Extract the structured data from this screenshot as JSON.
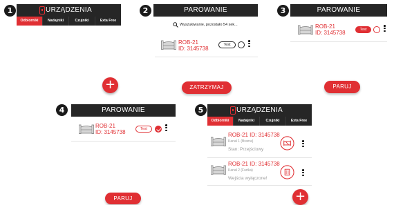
{
  "steps": [
    "1",
    "2",
    "3",
    "4",
    "5"
  ],
  "screen1": {
    "title": "URZĄDZENIA",
    "tabs": [
      "Odbiorniki",
      "Nadajniki",
      "Czujniki",
      "Exta Free"
    ],
    "fab": "+"
  },
  "screen2": {
    "title": "PAROWANIE",
    "search_text": "Wyszukiwanie, pozostało 54 sek...",
    "device": {
      "name": "ROB-21",
      "id": "ID: 3145738",
      "test": "Test"
    },
    "button": "ZATRZYMAJ"
  },
  "screen3": {
    "title": "PAROWANIE",
    "device": {
      "name": "ROB-21",
      "id": "ID: 3145738",
      "test": "Test"
    },
    "button": "PARUJ"
  },
  "screen4": {
    "title": "PAROWANIE",
    "device": {
      "name": "ROB-21",
      "id": "ID: 3145738",
      "test": "Test"
    },
    "button": "PARUJ"
  },
  "screen5": {
    "title": "URZĄDZENIA",
    "tabs": [
      "Odbiorniki",
      "Nadajniki",
      "Czujniki",
      "Exta Free"
    ],
    "devices": [
      {
        "name": "ROB-21 ID: 3145738",
        "channel": "Kanał 1 (Brama)",
        "status": "Stan: Przejściowy"
      },
      {
        "name": "ROB-21 ID: 3145738",
        "channel": "Kanał 2 (Furtka)",
        "status": "Wejścia wyłączone!"
      }
    ],
    "fab": "+"
  },
  "icons": [
    "gate-icon",
    "search-icon",
    "kebab-menu-icon",
    "gate-channel-icon",
    "wicket-channel-icon",
    "plus-icon",
    "logo-icon"
  ],
  "colors": {
    "accent": "#e02f33",
    "header": "#262626"
  }
}
